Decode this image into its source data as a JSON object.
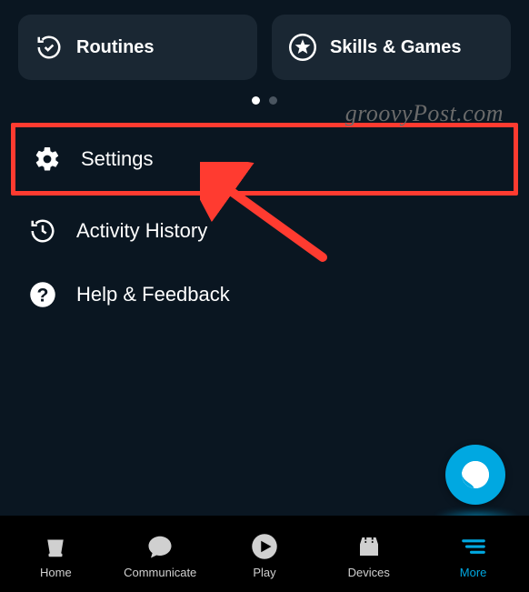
{
  "cards": {
    "routines": {
      "label": "Routines"
    },
    "skills": {
      "label": "Skills & Games"
    }
  },
  "pagination": {
    "current": 1,
    "total": 2
  },
  "menu": {
    "settings": {
      "label": "Settings"
    },
    "activity": {
      "label": "Activity History"
    },
    "help": {
      "label": "Help & Feedback"
    }
  },
  "watermark": "groovyPost.com",
  "nav": {
    "home": {
      "label": "Home"
    },
    "communicate": {
      "label": "Communicate"
    },
    "play": {
      "label": "Play"
    },
    "devices": {
      "label": "Devices"
    },
    "more": {
      "label": "More"
    }
  }
}
